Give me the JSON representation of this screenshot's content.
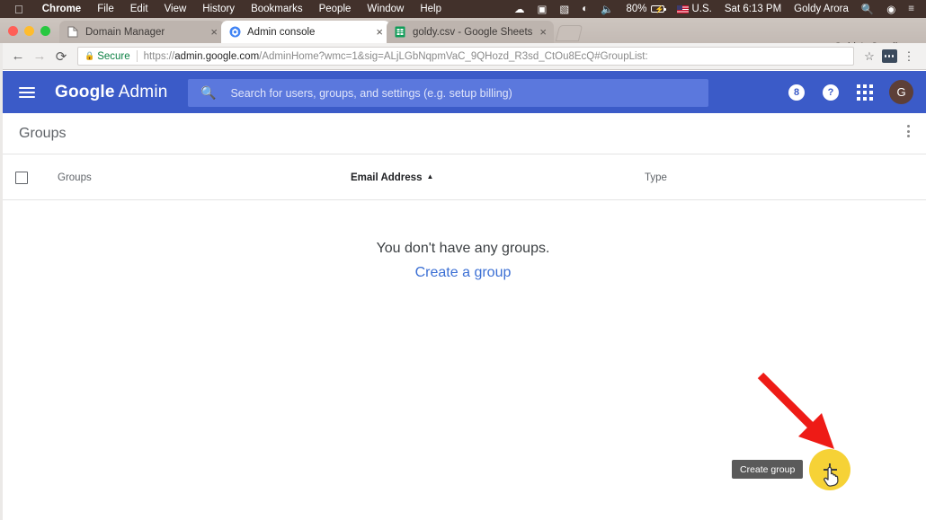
{
  "os_menubar": {
    "apple_icon": "apple-icon",
    "items": [
      {
        "label": "Chrome",
        "bold": true
      },
      {
        "label": "File",
        "bold": false
      },
      {
        "label": "Edit",
        "bold": false
      },
      {
        "label": "View",
        "bold": false
      },
      {
        "label": "History",
        "bold": false
      },
      {
        "label": "Bookmarks",
        "bold": false
      },
      {
        "label": "People",
        "bold": false
      },
      {
        "label": "Window",
        "bold": false
      },
      {
        "label": "Help",
        "bold": false
      }
    ],
    "status": {
      "dropbox_icon": "cloud-icon",
      "screen_record_icon": "video-camera-icon",
      "display_icon": "display-icon",
      "wifi_icon": "wifi-icon",
      "volume_icon": "speaker-icon",
      "battery_percent": "80%",
      "battery_icon": "battery-charging-icon",
      "input_flag_icon": "us-flag-icon",
      "input_source": "U.S.",
      "clock": "Sat 6:13 PM",
      "user": "Goldy Arora",
      "search_icon": "spotlight-search-icon",
      "siri_icon": "siri-icon",
      "control_center_icon": "notification-center-icon"
    }
  },
  "browser": {
    "tabs": [
      {
        "title": "Domain Manager",
        "favicon": "page-icon",
        "active": false,
        "close": "×"
      },
      {
        "title": "Admin console",
        "favicon": "admin-console-icon",
        "active": true,
        "close": "×"
      },
      {
        "title": "goldy.csv - Google Sheets",
        "favicon": "google-sheets-icon",
        "active": false,
        "close": "×"
      }
    ],
    "new_tab_icon": "new-tab-button",
    "profile_name": "Goldy's Sandbo…",
    "back_icon": "←",
    "forward_icon": "→",
    "reload_icon": "⟳",
    "security_badge": "Secure",
    "lock_icon": "lock-icon",
    "url_scheme": "https://",
    "url_domain": "admin.google.com",
    "url_path": "/AdminHome?wmc=1&sig=ALjLGbNqpmVaC_9QHozd_R3sd_CtOu8EcQ#GroupList:",
    "bookmark_icon": "☆",
    "extension_icon": "extension-icon",
    "menu_icon": "chrome-menu-icon"
  },
  "app_header": {
    "menu_icon": "hamburger-menu-icon",
    "brand_primary": "Google",
    "brand_secondary": "Admin",
    "search": {
      "icon": "search-icon",
      "placeholder": "Search for users, groups, and settings (e.g. setup billing)",
      "value": ""
    },
    "trial_badge": "8",
    "trial_icon": "trial-hourglass-icon",
    "help_icon": "?",
    "apps_icon": "apps-grid-icon",
    "avatar_letter": "G"
  },
  "page": {
    "title": "Groups",
    "more_menu_icon": "more-options-icon",
    "table": {
      "select_all_icon": "select-all-checkbox",
      "columns": [
        {
          "label": "Groups",
          "sorted": false
        },
        {
          "label": "Email Address",
          "sorted": true,
          "sort_caret": "▲"
        },
        {
          "label": "Type",
          "sorted": false
        }
      ],
      "rows": []
    },
    "empty_state": {
      "message": "You don't have any groups.",
      "link": "Create a group"
    },
    "fab": {
      "icon": "plus-icon",
      "tooltip": "Create group",
      "color": "#f6d236"
    },
    "annotation": {
      "arrow_icon": "red-arrow-annotation",
      "arrow_color": "#ee1b16"
    },
    "cursor_icon": "pointing-hand-cursor"
  },
  "colors": {
    "header_blue": "#3b5bc8",
    "search_blue": "#5b78dd",
    "link_blue": "#3b6fd4",
    "fab_yellow": "#f6d236",
    "tooltip_gray": "#5a5a5a",
    "menubar_brown": "#42312b",
    "avatar_brown": "#5d3f38"
  }
}
